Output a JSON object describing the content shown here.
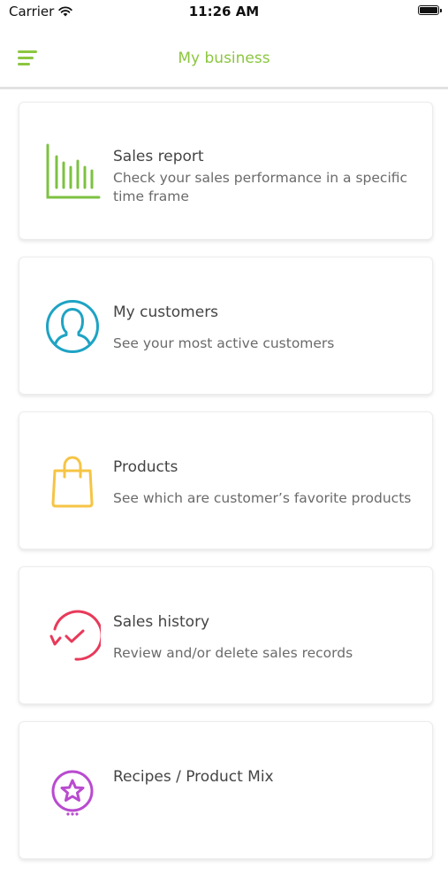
{
  "status_bar": {
    "carrier": "Carrier",
    "time": "11:26 AM"
  },
  "nav": {
    "title": "My business",
    "menu_icon": "hamburger-menu-icon",
    "accent_color": "#8cc63f"
  },
  "cards": [
    {
      "title": "Sales report",
      "description": "Check your sales performance in a specific time frame",
      "icon": "bar-chart-icon",
      "color": "#7dc142"
    },
    {
      "title": "My customers",
      "description": "See your most active customers",
      "icon": "customer-avatar-icon",
      "color": "#1ea3c4"
    },
    {
      "title": "Products",
      "description": "See which are customer’s favorite products",
      "icon": "shopping-bag-icon",
      "color": "#f6c445"
    },
    {
      "title": "Sales history",
      "description": "Review and/or delete sales records",
      "icon": "history-clock-icon",
      "color": "#e83a5a"
    },
    {
      "title": "Recipes / Product Mix",
      "description": "",
      "icon": "star-badge-icon",
      "color": "#b94bd0"
    }
  ]
}
